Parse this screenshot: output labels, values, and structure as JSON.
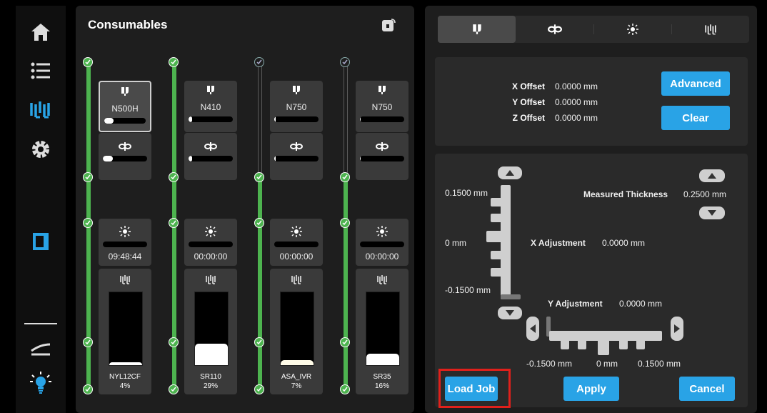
{
  "nav": {
    "items": [
      "home-icon",
      "list-icon",
      "resin-icon",
      "gear-icon",
      "door-icon",
      "tray-icon",
      "lightbulb-icon"
    ]
  },
  "consumables": {
    "title": "Consumables",
    "columns": [
      {
        "nozzle": "N500H",
        "nozzle_level": 0.22,
        "fan_level": 0.22,
        "time": "09:48:44",
        "resin": "NYL12CF",
        "pct": "4%",
        "resin_level": 0.04,
        "selected": true,
        "filled": true
      },
      {
        "nozzle": "N410",
        "nozzle_level": 0.08,
        "fan_level": 0.08,
        "time": "00:00:00",
        "resin": "SR110",
        "pct": "29%",
        "resin_level": 0.29,
        "selected": false,
        "filled": true
      },
      {
        "nozzle": "N750",
        "nozzle_level": 0.04,
        "fan_level": 0.04,
        "time": "00:00:00",
        "resin": "ASA_IVR",
        "pct": "7%",
        "resin_level": 0.07,
        "selected": false,
        "filled": false
      },
      {
        "nozzle": "N750",
        "nozzle_level": 0.01,
        "fan_level": 0.01,
        "time": "00:00:00",
        "resin": "SR35",
        "pct": "16%",
        "resin_level": 0.16,
        "selected": false,
        "filled": false
      }
    ]
  },
  "tabs": [
    "nozzle-tab",
    "fan-tab",
    "light-tab",
    "resin-tab"
  ],
  "offsets": {
    "x_label": "X Offset",
    "x_value": "0.0000 mm",
    "y_label": "Y Offset",
    "y_value": "0.0000 mm",
    "z_label": "Z Offset",
    "z_value": "0.0000 mm",
    "advanced": "Advanced",
    "clear": "Clear"
  },
  "adjust": {
    "v_top": "0.1500 mm",
    "v_mid": "0 mm",
    "v_bot": "-0.1500 mm",
    "measured_label": "Measured Thickness",
    "measured_value": "0.2500 mm",
    "x_adj_label": "X Adjustment",
    "x_adj_value": "0.0000 mm",
    "y_adj_label": "Y Adjustment",
    "y_adj_value": "0.0000 mm",
    "h_left": "-0.1500 mm",
    "h_mid": "0 mm",
    "h_right": "0.1500 mm"
  },
  "actions": {
    "load_job": "Load Job",
    "apply": "Apply",
    "cancel": "Cancel"
  },
  "colors": {
    "accent": "#29a3e6",
    "green": "#4db34f",
    "highlight": "#e0201b"
  }
}
